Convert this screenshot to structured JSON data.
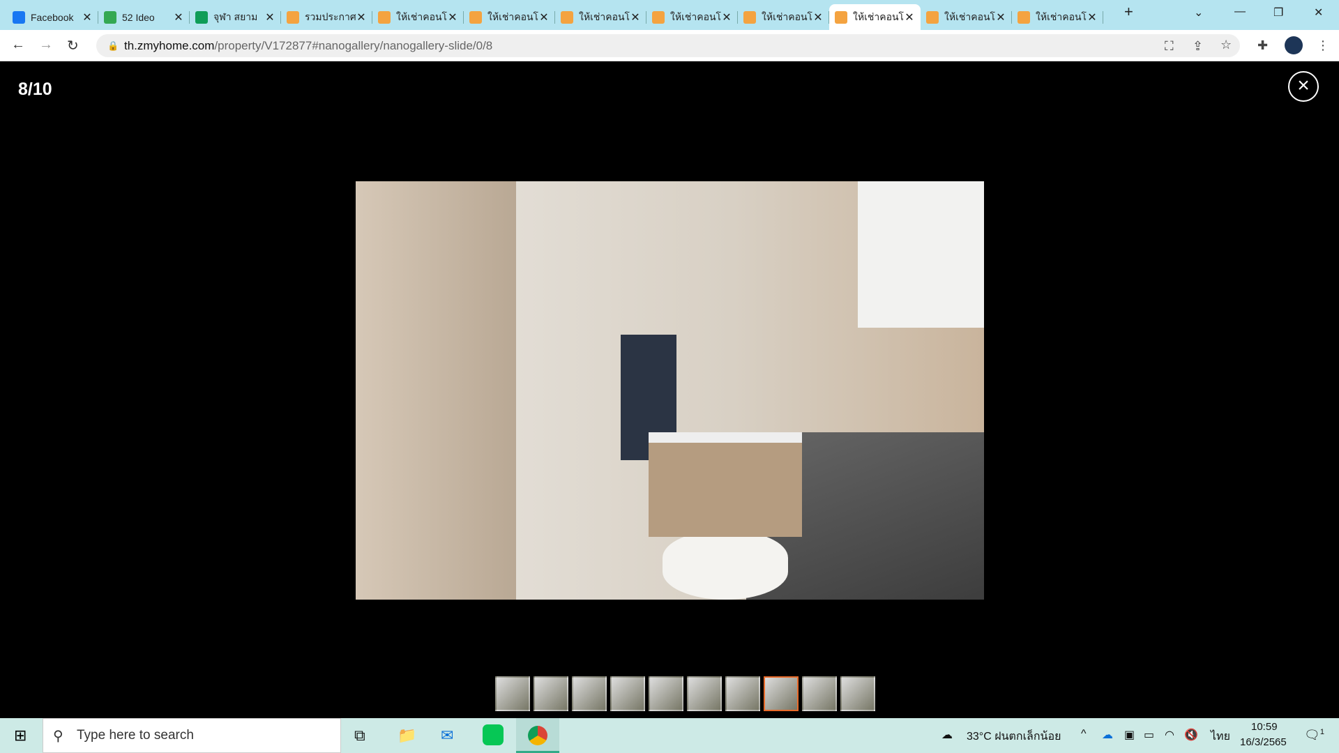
{
  "browser": {
    "tabs": [
      {
        "title": "Facebook",
        "icon": "facebook-icon",
        "color": "#1877f2"
      },
      {
        "title": "52 Ideo",
        "icon": "google-drive-icon",
        "color": "#34a853"
      },
      {
        "title": "จุฬา สยาม",
        "icon": "google-sheets-icon",
        "color": "#0f9d58"
      },
      {
        "title": "รวมประกาศ",
        "icon": "zmyhome-icon",
        "color": "#f4a340"
      },
      {
        "title": "ให้เช่าคอนโด",
        "icon": "zmyhome-icon",
        "color": "#f4a340"
      },
      {
        "title": "ให้เช่าคอนโด",
        "icon": "zmyhome-icon",
        "color": "#f4a340"
      },
      {
        "title": "ให้เช่าคอนโด",
        "icon": "zmyhome-icon",
        "color": "#f4a340"
      },
      {
        "title": "ให้เช่าคอนโด",
        "icon": "zmyhome-icon",
        "color": "#f4a340"
      },
      {
        "title": "ให้เช่าคอนโด",
        "icon": "zmyhome-icon",
        "color": "#f4a340"
      },
      {
        "title": "ให้เช่าคอนโด",
        "icon": "zmyhome-icon",
        "color": "#f4a340",
        "active": true
      },
      {
        "title": "ให้เช่าคอนโด",
        "icon": "zmyhome-icon",
        "color": "#f4a340"
      },
      {
        "title": "ให้เช่าคอนโด",
        "icon": "zmyhome-icon",
        "color": "#f4a340"
      }
    ],
    "url_host": "th.zmyhome.com",
    "url_path": "/property/V172877#nanogallery/nanogallery-slide/0/8"
  },
  "gallery": {
    "counter": "8/10",
    "current": 8,
    "total": 10,
    "accent": "#e86a2a"
  },
  "taskbar": {
    "search_placeholder": "Type here to search",
    "weather": "33°C ฝนตกเล็กน้อย",
    "lang": "ไทย",
    "time": "10:59",
    "date": "16/3/2565",
    "notifications": "1"
  }
}
